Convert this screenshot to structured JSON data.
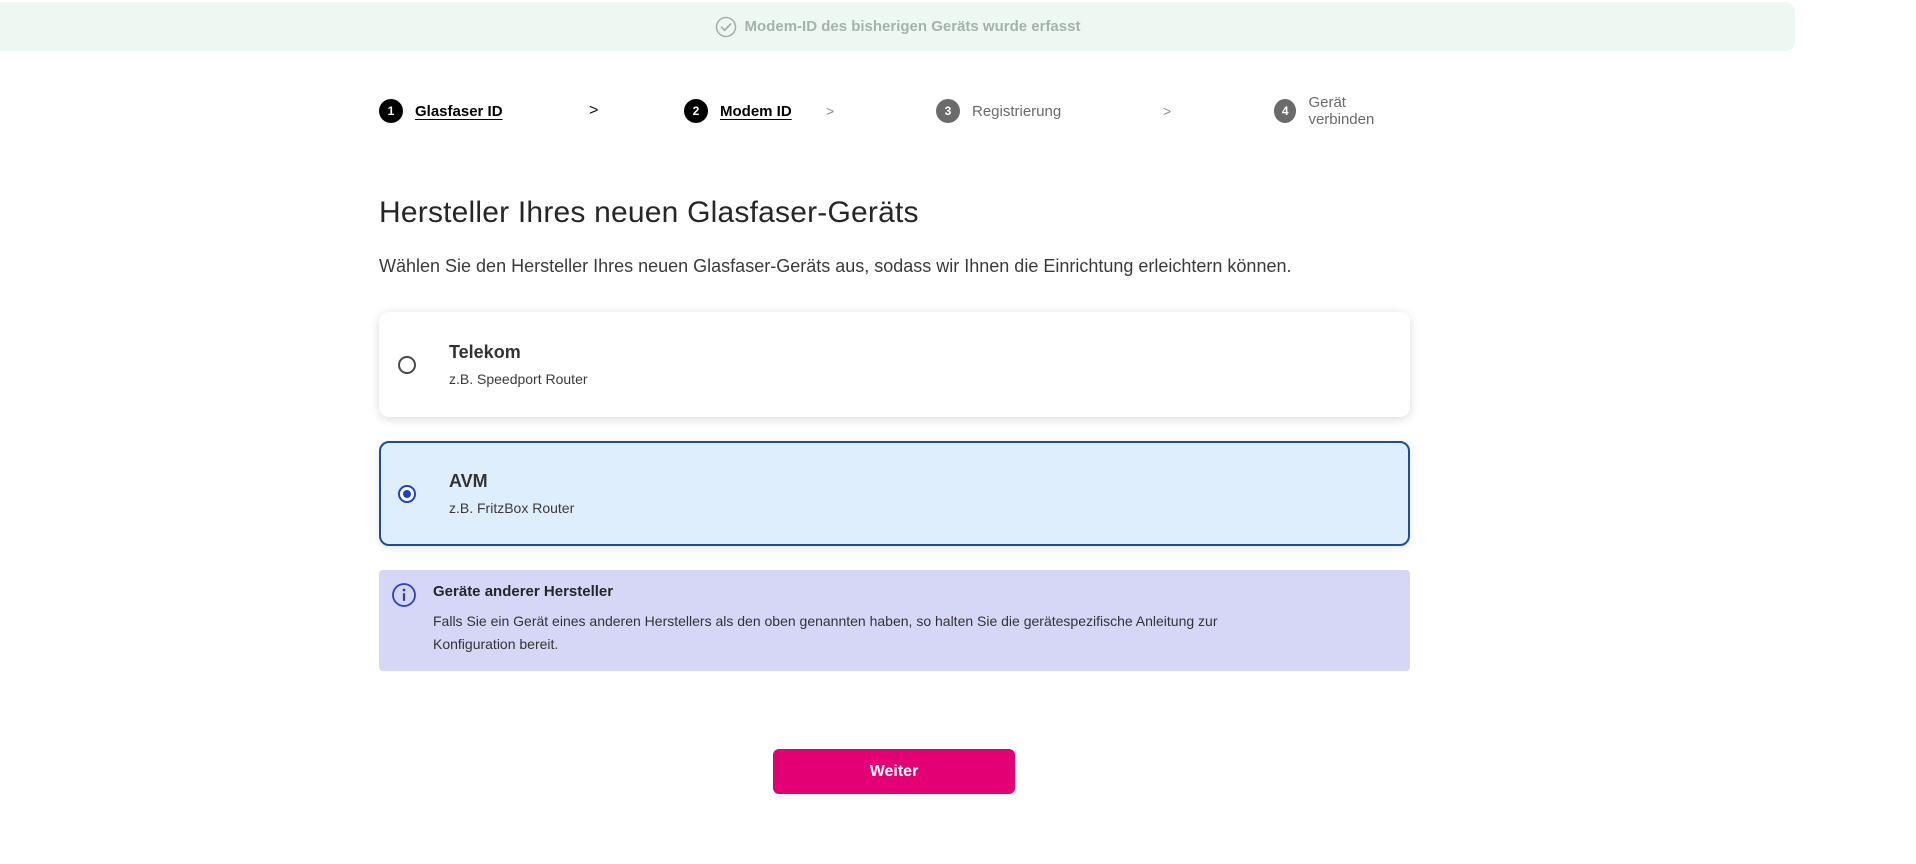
{
  "banner": {
    "icon": "check-circle-icon",
    "text": "Modem-ID des bisherigen Geräts wurde erfasst",
    "color": "#a3b3ab",
    "background": "#eef8f3"
  },
  "stepper": {
    "steps": [
      {
        "number": "1",
        "label": "Glasfaser ID",
        "state": "active"
      },
      {
        "number": "2",
        "label": "Modem ID",
        "state": "active"
      },
      {
        "number": "3",
        "label": "Registrierung",
        "state": "inactive"
      },
      {
        "number": "4",
        "label": "Gerät verbinden",
        "state": "inactive"
      }
    ],
    "separator": ">"
  },
  "page": {
    "title": "Hersteller Ihres neuen Glasfaser-Geräts",
    "subtitle": "Wählen Sie den Hersteller Ihres neuen Glasfaser-Geräts aus, sodass wir Ihnen die Einrichtung erleichtern können."
  },
  "options": [
    {
      "title": "Telekom",
      "subtitle": "z.B. Speedport Router",
      "selected": false
    },
    {
      "title": "AVM",
      "subtitle": "z.B. FritzBox Router",
      "selected": true
    }
  ],
  "info": {
    "icon": "info-icon",
    "title": "Geräte anderer Hersteller",
    "text": "Falls Sie ein Gerät eines anderen Herstellers als den oben genannten haben, so halten Sie die gerätespezifische Anleitung zur Konfiguration bereit."
  },
  "actions": {
    "next_label": "Weiter"
  },
  "colors": {
    "brand": "#e20074",
    "selected_border": "#1f4f8f",
    "selected_background": "#deeefd",
    "radio_accent": "#2140c8",
    "info_background": "#d6d7f7"
  }
}
